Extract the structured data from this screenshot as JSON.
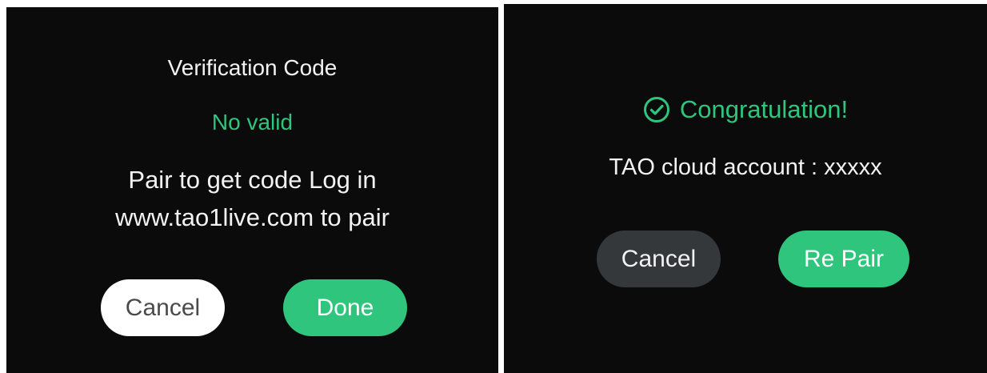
{
  "verification_dialog": {
    "title": "Verification Code",
    "status": "No valid",
    "instruction_line1": "Pair to get code Log in",
    "instruction_line2": "www.tao1live.com to pair",
    "cancel_label": "Cancel",
    "done_label": "Done"
  },
  "success_dialog": {
    "icon": "check-circle-icon",
    "heading": "Congratulation!",
    "account_text": "TAO cloud account : xxxxx",
    "cancel_label": "Cancel",
    "repair_label": "Re Pair"
  },
  "colors": {
    "panel_background": "#0b0b0c",
    "accent_green": "#2fc57d",
    "dark_button": "#35383b",
    "light_button": "#ffffff"
  }
}
